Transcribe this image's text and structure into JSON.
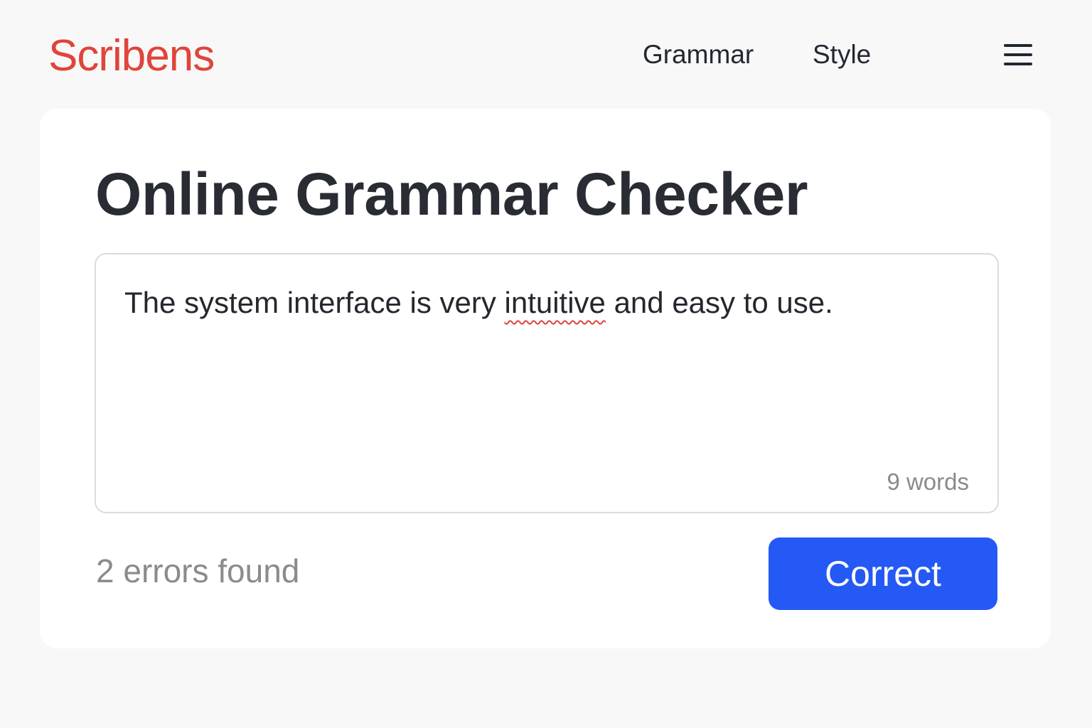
{
  "header": {
    "logo": "Scribens",
    "nav": [
      {
        "label": "Grammar"
      },
      {
        "label": "Style"
      }
    ],
    "menu_icon": "hamburger-menu-icon"
  },
  "main": {
    "title": "Online Grammar Checker",
    "editor": {
      "text_before": "The system interface is very ",
      "flagged_word": "intuitive",
      "text_after": " and easy to use.",
      "word_count": "9 words"
    },
    "status": "2 errors found",
    "correct_label": "Correct"
  },
  "colors": {
    "brand": "#e0443a",
    "primary_button": "#2559f5",
    "error_underline": "#e0443a",
    "background": "#f8f8f8",
    "card": "#ffffff"
  }
}
